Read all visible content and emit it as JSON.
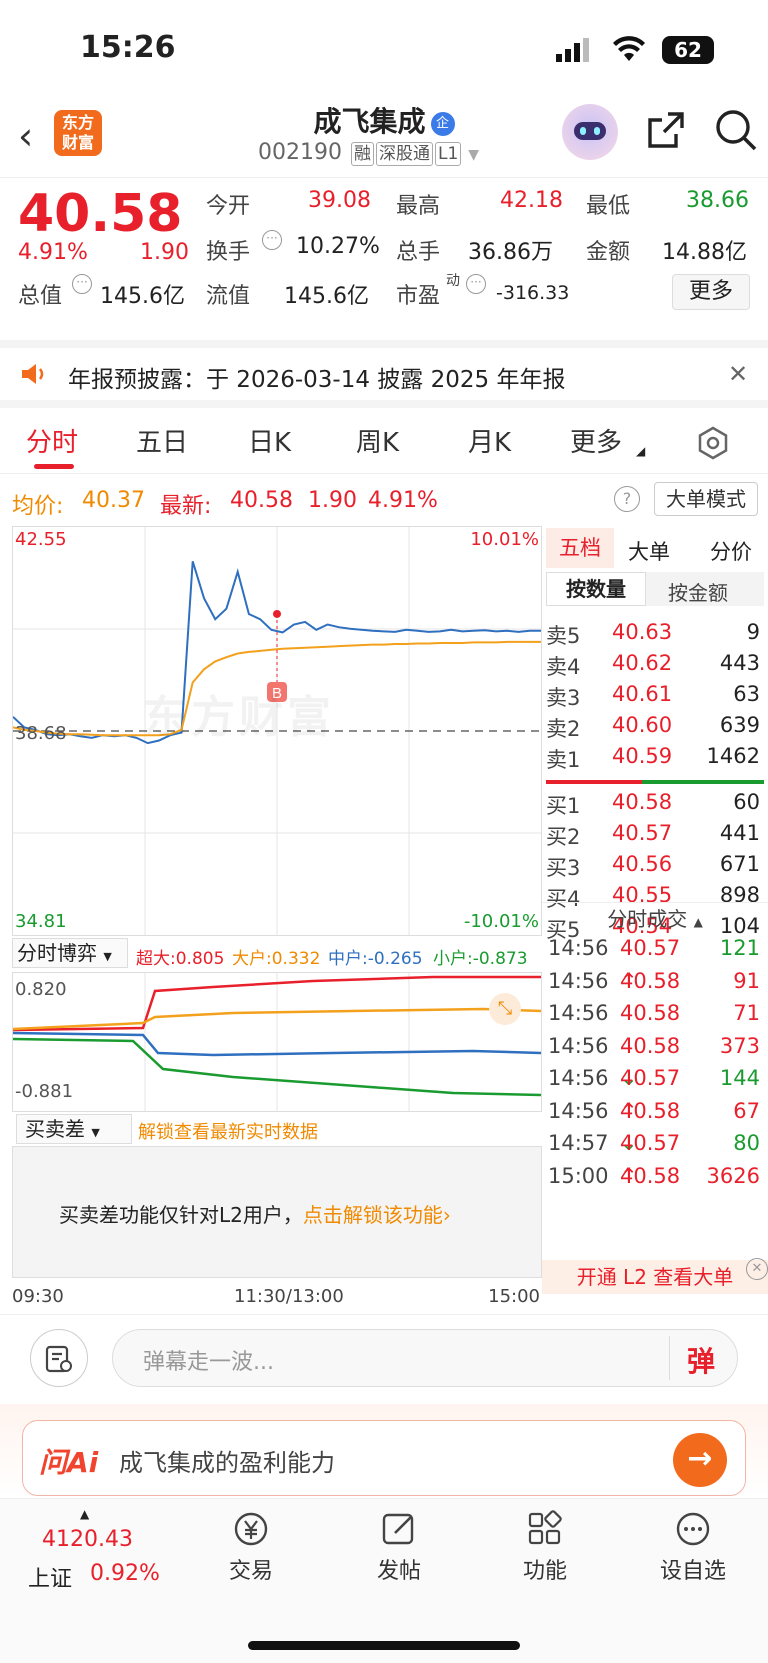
{
  "status": {
    "time": "15:26",
    "battery": "62"
  },
  "header": {
    "logo": "东方\n财富",
    "name": "成飞集成",
    "badge": "企",
    "code": "002190",
    "tags": [
      "融",
      "深股通",
      "L1"
    ]
  },
  "quote": {
    "price": "40.58",
    "pct": "4.91%",
    "chg": "1.90",
    "open_label": "今开",
    "open": "39.08",
    "high_label": "最高",
    "high": "42.18",
    "low_label": "最低",
    "low": "38.66",
    "turnover_label": "换手",
    "turnover": "10.27%",
    "volume_label": "总手",
    "volume": "36.86万",
    "amount_label": "金额",
    "amount": "14.88亿",
    "mktcap_label": "总值",
    "mktcap": "145.6亿",
    "float_label": "流值",
    "float": "145.6亿",
    "pe_label": "市盈",
    "pe_sup": "动",
    "pe": "-316.33",
    "more": "更多"
  },
  "notice": {
    "text": "年报预披露：于 2026-03-14 披露 2025 年年报"
  },
  "tabs": [
    "分时",
    "五日",
    "日K",
    "周K",
    "月K",
    "更多"
  ],
  "avg": {
    "avg_label": "均价:",
    "avg": "40.37",
    "last_label": "最新:",
    "last": "40.58",
    "chg": "1.90",
    "pct": "4.91%",
    "mode": "大单模式"
  },
  "chart_data": {
    "type": "line",
    "title": "",
    "y_max": "42.55",
    "y_min": "34.81",
    "y_ref": "38.68",
    "pct_max": "10.01%",
    "pct_min": "-10.01%",
    "ylim": [
      34.81,
      42.55
    ],
    "x_labels": [
      "09:30",
      "11:30/13:00",
      "15:00"
    ],
    "series": [
      {
        "name": "价格",
        "color": "#2f6fbf",
        "values": [
          38.95,
          38.75,
          38.7,
          38.62,
          38.6,
          38.62,
          38.58,
          38.55,
          38.6,
          38.58,
          38.6,
          38.55,
          38.45,
          38.5,
          38.6,
          38.65,
          41.9,
          41.2,
          40.8,
          41.0,
          41.7,
          40.9,
          40.8,
          40.6,
          40.55,
          40.7,
          40.75,
          40.6,
          40.7,
          40.65,
          40.62,
          40.6,
          40.58,
          40.57,
          40.56,
          40.6,
          40.58,
          40.56,
          40.57,
          40.6,
          40.57,
          40.58,
          40.59,
          40.57,
          40.58,
          40.56,
          40.58,
          40.58
        ]
      },
      {
        "name": "均价",
        "color": "#f3a01c",
        "values": [
          38.75,
          38.7,
          38.68,
          38.65,
          38.63,
          38.62,
          38.62,
          38.61,
          38.6,
          38.6,
          38.6,
          38.6,
          38.6,
          38.6,
          38.62,
          38.7,
          39.6,
          39.85,
          40.0,
          40.08,
          40.15,
          40.18,
          40.2,
          40.22,
          40.24,
          40.25,
          40.26,
          40.27,
          40.28,
          40.29,
          40.3,
          40.31,
          40.32,
          40.32,
          40.33,
          40.33,
          40.34,
          40.34,
          40.35,
          40.35,
          40.35,
          40.36,
          40.36,
          40.36,
          40.37,
          40.37,
          40.37,
          40.37
        ]
      }
    ],
    "marker": "B",
    "watermark": "东方财富"
  },
  "fund": {
    "selector": "分时博弈",
    "super_label": "超大:",
    "super": "0.805",
    "big_label": "大户:",
    "big": "0.332",
    "mid_label": "中户:",
    "mid": "-0.265",
    "small_label": "小户:",
    "small": "-0.873",
    "y_max": "0.820",
    "y_min": "-0.881"
  },
  "diff": {
    "selector": "买卖差",
    "unlock": "解锁查看最新实时数据",
    "msg": "买卖差功能仅针对L2用户，",
    "link": "点击解锁该功能"
  },
  "book": {
    "tabs": [
      "五档",
      "大单",
      "分价"
    ],
    "subtabs": [
      "按数量",
      "按金额"
    ],
    "asks": [
      {
        "label": "卖5",
        "price": "40.63",
        "vol": "9"
      },
      {
        "label": "卖4",
        "price": "40.62",
        "vol": "443"
      },
      {
        "label": "卖3",
        "price": "40.61",
        "vol": "63"
      },
      {
        "label": "卖2",
        "price": "40.60",
        "vol": "639"
      },
      {
        "label": "卖1",
        "price": "40.59",
        "vol": "1462"
      }
    ],
    "bids": [
      {
        "label": "买1",
        "price": "40.58",
        "vol": "60"
      },
      {
        "label": "买2",
        "price": "40.57",
        "vol": "441"
      },
      {
        "label": "买3",
        "price": "40.56",
        "vol": "671"
      },
      {
        "label": "买4",
        "price": "40.55",
        "vol": "898"
      },
      {
        "label": "买5",
        "price": "40.54",
        "vol": "104"
      }
    ],
    "trades_title": "分时成交",
    "trades": [
      {
        "time": "14:56",
        "price": "40.57",
        "arrow": "",
        "vol": "121",
        "dir": "g"
      },
      {
        "time": "14:56",
        "price": "40.58",
        "arrow": "↑",
        "vol": "91",
        "dir": "r"
      },
      {
        "time": "14:56",
        "price": "40.58",
        "arrow": "",
        "vol": "71",
        "dir": "r"
      },
      {
        "time": "14:56",
        "price": "40.58",
        "arrow": "",
        "vol": "373",
        "dir": "r"
      },
      {
        "time": "14:56",
        "price": "40.57",
        "arrow": "↓",
        "vol": "144",
        "dir": "g"
      },
      {
        "time": "14:56",
        "price": "40.58",
        "arrow": "↑",
        "vol": "67",
        "dir": "r"
      },
      {
        "time": "14:57",
        "price": "40.57",
        "arrow": "↓",
        "vol": "80",
        "dir": "g"
      },
      {
        "time": "15:00",
        "price": "40.58",
        "arrow": "↑",
        "vol": "3626",
        "dir": "r"
      }
    ],
    "l2_banner": "开通 L2 查看大单"
  },
  "comment": {
    "placeholder": "弹幕走一波...",
    "btn": "弹"
  },
  "ai": {
    "logo": "问Ai",
    "prompt": "成飞集成的盈利能力"
  },
  "nav": {
    "index_value": "4120.43",
    "index_name": "上证",
    "index_pct": "0.92%",
    "items": [
      "交易",
      "发帖",
      "功能",
      "设自选"
    ]
  },
  "colors": {
    "up": "#e8202b",
    "down": "#1a9b2f",
    "accent": "#f26b1d",
    "price_line": "#2f6fbf",
    "avg_line": "#f3a01c"
  }
}
